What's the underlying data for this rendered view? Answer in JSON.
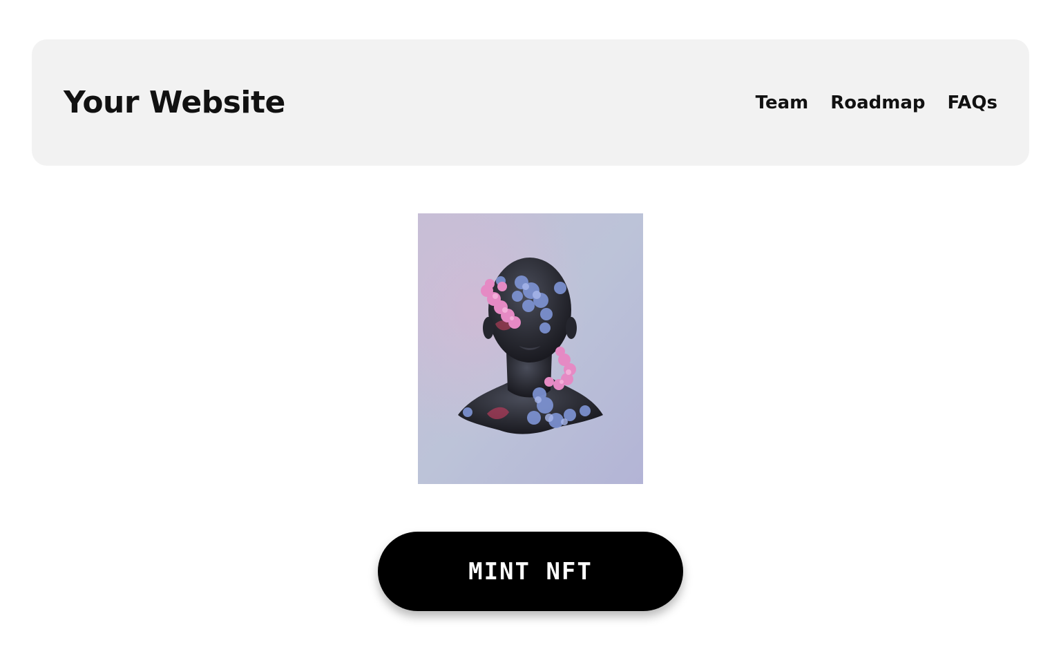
{
  "header": {
    "title": "Your Website",
    "nav": [
      {
        "label": "Team"
      },
      {
        "label": "Roadmap"
      },
      {
        "label": "FAQs"
      }
    ]
  },
  "main": {
    "artwork_icon": "nft-bust-artwork",
    "mint_label": "MINT NFT"
  },
  "colors": {
    "header_bg": "#f2f2f2",
    "button_bg": "#000000",
    "button_text": "#ffffff",
    "text": "#111111"
  }
}
